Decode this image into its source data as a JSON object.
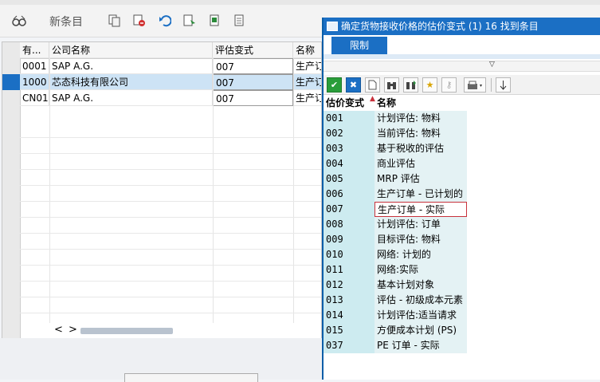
{
  "toolbar": {
    "new_item_label": "新条目",
    "icons": [
      "glasses-icon",
      "copy-icon",
      "delete-icon",
      "undo-icon",
      "select-all-icon",
      "select-block-icon",
      "deselect-icon"
    ]
  },
  "grid": {
    "headers": [
      "有...",
      "公司名称",
      "评估变式",
      "名称"
    ],
    "rows": [
      {
        "code": "0001",
        "company": "SAP A.G.",
        "variant": "007",
        "name": "生产订",
        "selected": false
      },
      {
        "code": "1000",
        "company": "芯态科技有限公司",
        "variant": "007",
        "name": "生产订",
        "selected": true
      },
      {
        "code": "CN01",
        "company": "SAP A.G.",
        "variant": "007",
        "name": "生产订",
        "selected": false
      }
    ],
    "scroll_left": "<",
    "scroll_right": ">"
  },
  "popup": {
    "title": "确定货物接收价格的估价变式 (1)   16 找到条目",
    "tab": "限制",
    "col_code": "估价变式",
    "col_name": "名称",
    "highlight_code": "007",
    "entries": [
      {
        "code": "001",
        "name": "计划评估: 物料"
      },
      {
        "code": "002",
        "name": "当前评估: 物料"
      },
      {
        "code": "003",
        "name": "基于税收的评估"
      },
      {
        "code": "004",
        "name": "商业评估"
      },
      {
        "code": "005",
        "name": "MRP 评估"
      },
      {
        "code": "006",
        "name": "生产订单 - 已计划的"
      },
      {
        "code": "007",
        "name": "生产订单 - 实际"
      },
      {
        "code": "008",
        "name": "计划评估: 订单"
      },
      {
        "code": "009",
        "name": "目标评估: 物料"
      },
      {
        "code": "010",
        "name": "网络: 计划的"
      },
      {
        "code": "011",
        "name": "网络:实际"
      },
      {
        "code": "012",
        "name": "基本计划对象"
      },
      {
        "code": "013",
        "name": "评估 - 初级成本元素"
      },
      {
        "code": "014",
        "name": "计划评估:适当请求"
      },
      {
        "code": "015",
        "name": "方便成本计划 (PS)"
      },
      {
        "code": "037",
        "name": "PE 订单 - 实际"
      }
    ],
    "toolbar_icons": [
      "check-icon",
      "cancel-icon",
      "new-document-icon",
      "find-icon",
      "find-next-icon",
      "add-favorite-icon",
      "key-icon",
      "print-icon",
      "sort-icon"
    ]
  },
  "colors": {
    "accent": "#1b6fc4",
    "selected_row": "#cde3f5",
    "code_bg": "#cdebf0",
    "highlight_border": "#c8323c"
  }
}
